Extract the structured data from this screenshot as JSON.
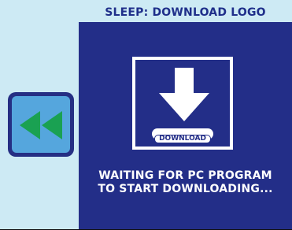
{
  "screen": {
    "title": "SLEEP: DOWNLOAD LOGO"
  },
  "logo": {
    "icon": "download-arrow-icon",
    "badge_label": "DOWNLOAD"
  },
  "status": {
    "line1": "WAITING FOR PC PROGRAM",
    "line2": "TO START DOWNLOADING..."
  },
  "back_button": {
    "icon": "rewind-back-icon"
  },
  "colors": {
    "panel_background": "#232e88",
    "screen_background": "#cdeaf4",
    "title_text": "#1f2f8a",
    "back_button_fill": "#55a6dd",
    "back_arrow_green": "#1aa152"
  }
}
